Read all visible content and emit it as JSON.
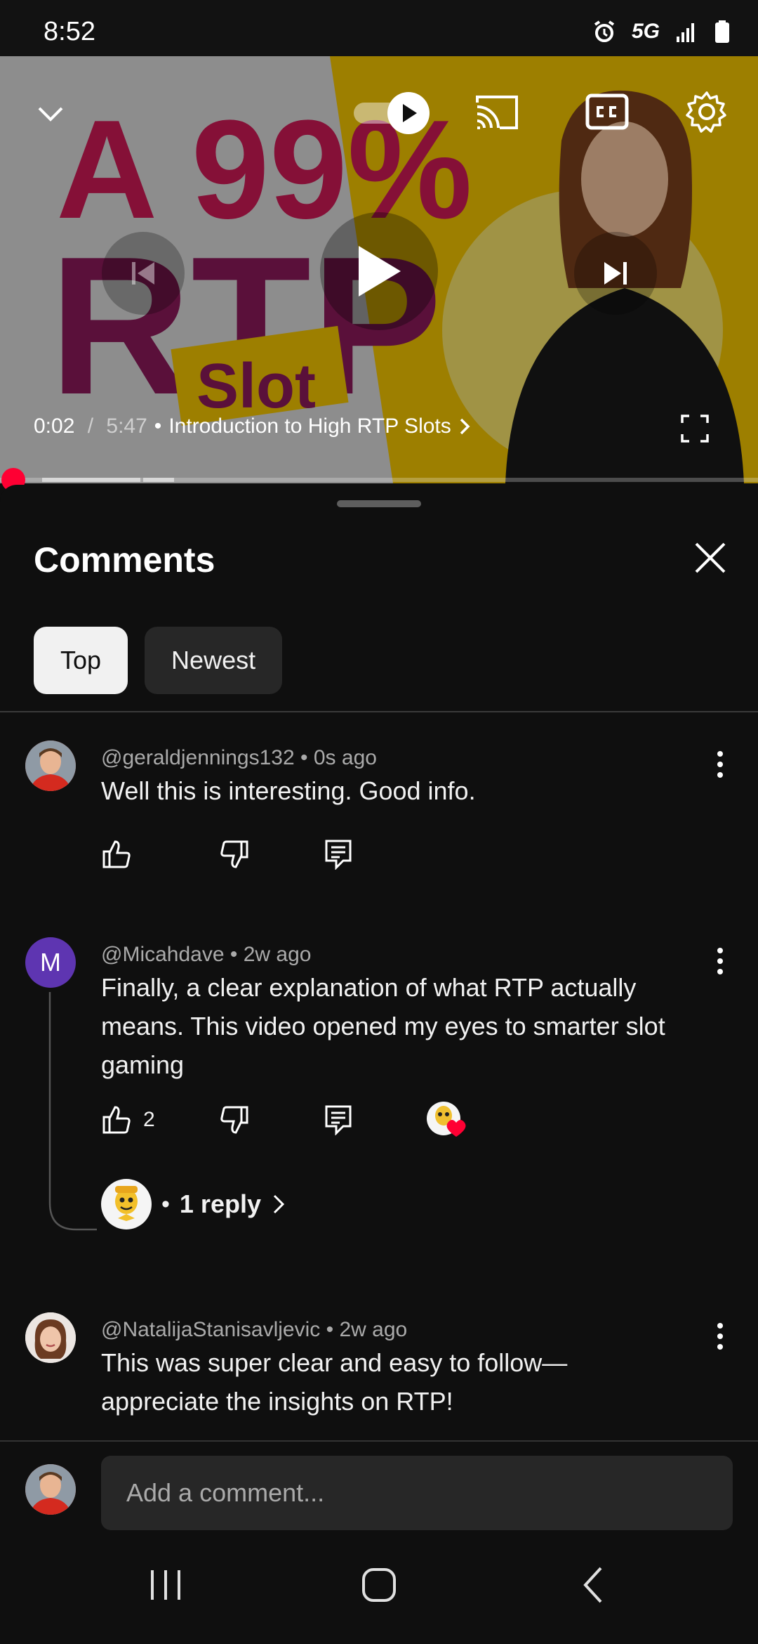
{
  "status_bar": {
    "time": "8:52",
    "network": "5G",
    "icons": [
      "alarm-icon",
      "signal-icon",
      "battery-icon"
    ]
  },
  "video": {
    "thumbnail_text": {
      "line1": "A 99%",
      "line2": "RTP",
      "line3": "Slot"
    },
    "current_time": "0:02",
    "separator": " / ",
    "duration": "5:47",
    "chapter_separator": "•",
    "chapter_title": "Introduction to High RTP Slots",
    "autoplay": "on",
    "progress_fraction": 0.006
  },
  "comments_panel": {
    "title": "Comments",
    "tabs": [
      {
        "label": "Top",
        "active": true
      },
      {
        "label": "Newest",
        "active": false
      }
    ],
    "comments": [
      {
        "author": "@geraldjennings132",
        "time": "0s ago",
        "text": "Well this is interesting. Good info.",
        "likes": "",
        "avatar_initial": ""
      },
      {
        "author": "@Micahdave",
        "time": "2w ago",
        "text": "Finally, a clear explanation of what RTP actually means. This video opened my eyes to smarter slot gaming",
        "likes": "2",
        "avatar_initial": "M",
        "replies_label": "1 reply",
        "reply_bullet": "•"
      },
      {
        "author": "@NatalijaStanisavljevic",
        "time": "2w ago",
        "text": "This was super clear and easy to follow—appreciate the insights on RTP!",
        "likes": "",
        "avatar_initial": ""
      }
    ],
    "meta_separator": "•",
    "add_comment_placeholder": "Add a comment..."
  },
  "colors": {
    "background": "#0f0f0f",
    "chip_active": "#f1f1f1",
    "chip_inactive": "#272727",
    "progress": "#ff0033",
    "avatar_m": "#5e35b1",
    "heart": "#ff0033"
  }
}
